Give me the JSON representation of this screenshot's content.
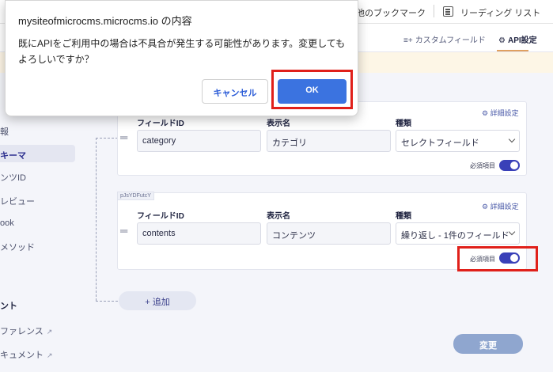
{
  "browser": {
    "bookmarks": {
      "other": "他のブックマーク",
      "reading_list": "リーディング リスト"
    }
  },
  "app_tabs": {
    "custom_field": "カスタムフィールド",
    "api_settings": "API設定"
  },
  "sidebar": {
    "items": [
      "報",
      "キーマ",
      "ンツID",
      "レビュー",
      "ook",
      "メソッド"
    ],
    "active_index": 1,
    "section": "ント",
    "links": [
      "ファレンス",
      "キュメント"
    ]
  },
  "fields": [
    {
      "detail": "詳細設定",
      "id_label": "フィールドID",
      "name_label": "表示名",
      "type_label": "種類",
      "id": "category",
      "name": "カテゴリ",
      "type": "セレクトフィールド",
      "required_label": "必須項目",
      "required": true
    },
    {
      "tag": "pJsYDFutcY",
      "detail": "詳細設定",
      "id_label": "フィールドID",
      "name_label": "表示名",
      "type_label": "種類",
      "id": "contents",
      "name": "コンテンツ",
      "type": "繰り返し - 1件のフィールド",
      "required_label": "必須項目",
      "required": true
    }
  ],
  "buttons": {
    "add": "+ 追加",
    "change": "変更"
  },
  "dialog": {
    "title": "mysiteofmicrocms.microcms.io の内容",
    "message": "既にAPIをご利用中の場合は不具合が発生する可能性があります。変更してもよろしいですか？",
    "cancel": "キャンセル",
    "ok": "OK"
  },
  "colors": {
    "accent": "#3940b8",
    "ok_button": "#3b73e0",
    "highlight": "#e0201a"
  },
  "icons": [
    "gear-icon",
    "reading-list-icon",
    "external-link-icon",
    "chevron-down-icon",
    "drag-handle-icon"
  ]
}
